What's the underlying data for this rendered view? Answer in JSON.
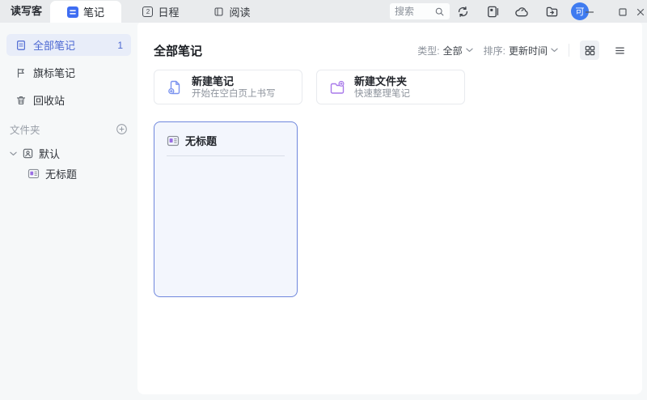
{
  "titlebar": {
    "app_name": "读写客",
    "tabs": [
      {
        "label": "笔记",
        "active": true
      },
      {
        "label": "日程",
        "active": false,
        "badge": "2"
      },
      {
        "label": "阅读",
        "active": false
      }
    ],
    "search": {
      "placeholder": "搜索"
    },
    "avatar_text": "可"
  },
  "icons": {
    "tab_notes": "blue-rounded-square-with-list-lines",
    "tab_schedule": "calendar-with-2",
    "tab_reading": "book",
    "search": "magnifier",
    "toolbar": [
      "sync-arrows",
      "notebook-page",
      "cloud",
      "folder-share"
    ],
    "window_controls": [
      "minimize",
      "maximize",
      "close"
    ],
    "sidebar": [
      "document",
      "flag",
      "trash",
      "plus-circle",
      "chevron-down",
      "user-card",
      "note"
    ],
    "main": [
      "chevron-down",
      "grid-view",
      "list-view",
      "new-file-plus",
      "folder-plus",
      "note"
    ]
  },
  "sidebar": {
    "items": [
      {
        "label": "全部笔记",
        "count": "1",
        "active": true
      },
      {
        "label": "旗标笔记",
        "active": false
      },
      {
        "label": "回收站",
        "active": false
      }
    ],
    "folders": {
      "section_label": "文件夹",
      "items": [
        {
          "label": "默认",
          "expanded": true,
          "children": [
            {
              "label": "无标题"
            }
          ]
        }
      ]
    }
  },
  "main": {
    "title": "全部笔记",
    "filters": {
      "type_label": "类型:",
      "type_value": "全部",
      "sort_label": "排序:",
      "sort_value": "更新时间"
    },
    "view_toggle": {
      "active": "grid"
    },
    "actions": [
      {
        "title": "新建笔记",
        "subtitle": "开始在空白页上书写"
      },
      {
        "title": "新建文件夹",
        "subtitle": "快速整理笔记"
      }
    ],
    "notes": [
      {
        "title": "无标题"
      }
    ]
  },
  "colors": {
    "titlebar_bg": "#e9ebed",
    "page_bg": "#f6f8f9",
    "accent": "#4c68d2",
    "selected_bg": "#e8edf9",
    "tab_icon_blue": "#3e6df2",
    "avatar_blue": "#3f7bf0",
    "new_note_blue": "#7b93ef",
    "folder_purple": "#a879ea",
    "note_card_border": "#6f87dd",
    "note_card_bg": "#f3f6fd"
  }
}
